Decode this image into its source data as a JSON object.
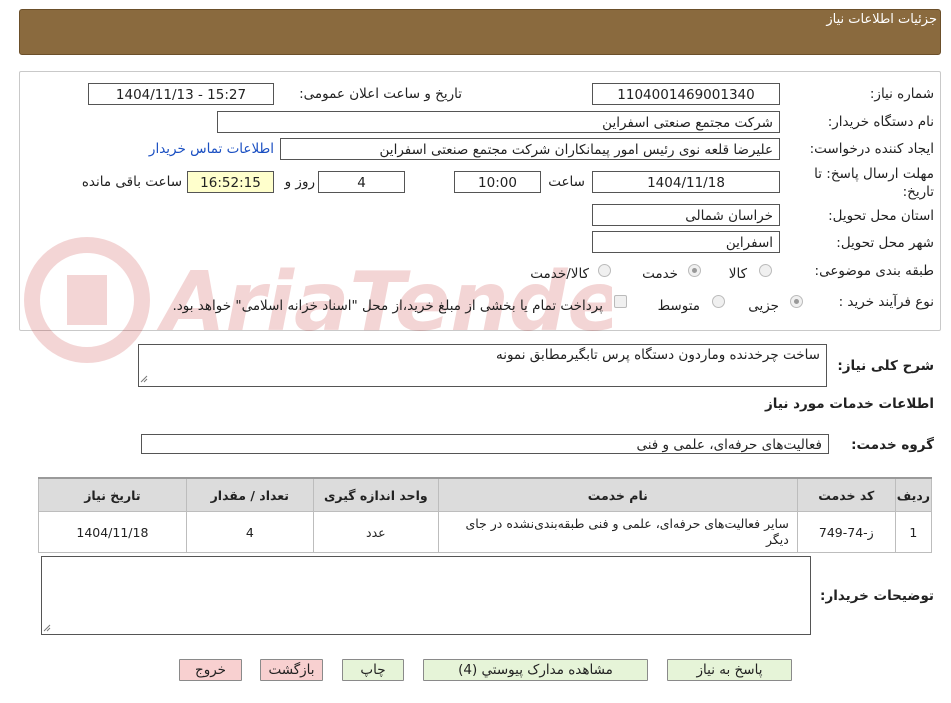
{
  "header": {
    "title": "جزئیات اطلاعات نیاز"
  },
  "form": {
    "need_number_label": "شماره نیاز:",
    "need_number": "1104001469001340",
    "announce_label": "تاریخ و ساعت اعلان عمومی:",
    "announce_value": "1404/11/13 - 15:27",
    "buyer_label": "نام دستگاه خریدار:",
    "buyer_value": "شرکت مجتمع صنعتی اسفراین",
    "creator_label": "ایجاد کننده درخواست:",
    "creator_value": "علیرضا قلعه نوی رئیس امور پیمانکاران شرکت مجتمع صنعتی اسفراین",
    "contact_link": "اطلاعات تماس خریدار",
    "deadline_label_1": "مهلت ارسال پاسخ: تا",
    "deadline_label_2": "تاریخ:",
    "deadline_date": "1404/11/18",
    "time_label": "ساعت",
    "deadline_time": "10:00",
    "days_value": "4",
    "days_label": "روز و",
    "remaining_time": "16:52:15",
    "remaining_label": "ساعت باقی مانده",
    "province_label": "استان محل تحویل:",
    "province_value": "خراسان شمالی",
    "city_label": "شهر محل تحویل:",
    "city_value": "اسفراین",
    "category_label": "طبقه بندی موضوعی:",
    "category_options": [
      "کالا",
      "خدمت",
      "کالا/خدمت"
    ],
    "process_label": "نوع فرآیند خرید :",
    "process_options": [
      "جزیی",
      "متوسط"
    ],
    "payment_note": "پرداخت تمام یا بخشی از مبلغ خرید،از محل \"اسناد خزانه اسلامی\" خواهد بود."
  },
  "description": {
    "label": "شرح کلی نیاز:",
    "value": "ساخت چرخدنده وماردون دستگاه پرس تابگیرمطابق نمونه"
  },
  "services": {
    "section_title": "اطلاعات خدمات مورد نیاز",
    "group_label": "گروه خدمت:",
    "group_value": "فعالیت‌های حرفه‌ای، علمی و فنی"
  },
  "table": {
    "headers": [
      "ردیف",
      "کد خدمت",
      "نام خدمت",
      "واحد اندازه گیری",
      "تعداد / مقدار",
      "تاریخ نیاز"
    ],
    "rows": [
      [
        "1",
        "ز-74-749",
        "سایر فعالیت‌های حرفه‌ای، علمی و فنی طبقه‌بندی‌نشده در جای دیگر",
        "عدد",
        "4",
        "1404/11/18"
      ]
    ]
  },
  "notes": {
    "label": "توضیحات خریدار:",
    "value": ""
  },
  "buttons": {
    "reply": "پاسخ به نیاز",
    "attachments": "مشاهده مدارک پیوستي (4)",
    "print": "چاپ",
    "back": "بازگشت",
    "exit": "خروج"
  },
  "watermark": {
    "text": "AriaTender.neT"
  },
  "colors": {
    "header": "#8a6a3e",
    "green_button": "#e6f4d8",
    "red_button": "#f8d0d0",
    "link": "#1a4fc2",
    "remaining_bg": "#ffffcc"
  }
}
